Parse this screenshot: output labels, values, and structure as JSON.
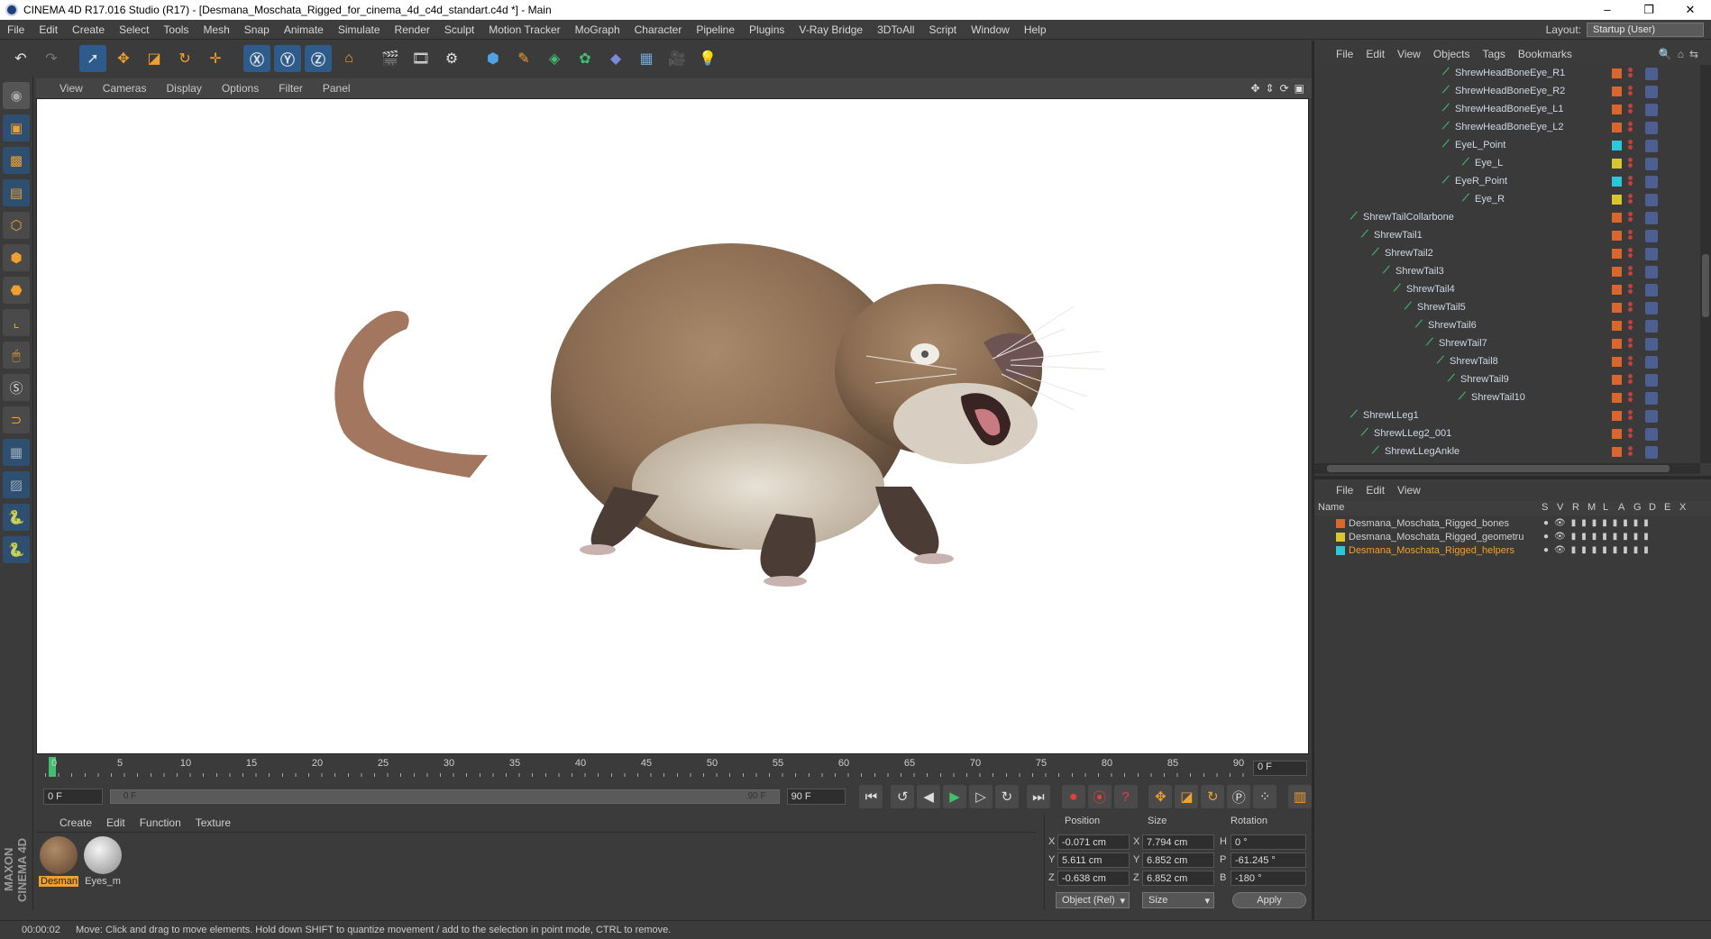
{
  "window": {
    "title": "CINEMA 4D R17.016 Studio (R17) - [Desmana_Moschata_Rigged_for_cinema_4d_c4d_standart.c4d *] - Main",
    "controls": [
      "–",
      "❐",
      "✕"
    ]
  },
  "menubar": {
    "items": [
      "File",
      "Edit",
      "Create",
      "Select",
      "Tools",
      "Mesh",
      "Snap",
      "Animate",
      "Simulate",
      "Render",
      "Sculpt",
      "Motion Tracker",
      "MoGraph",
      "Character",
      "Pipeline",
      "Plugins",
      "V-Ray Bridge",
      "3DToAll",
      "Script",
      "Window",
      "Help"
    ],
    "layout_label": "Layout:",
    "layout_value": "Startup (User)"
  },
  "viewport": {
    "menu": [
      "View",
      "Cameras",
      "Display",
      "Options",
      "Filter",
      "Panel"
    ]
  },
  "timeline": {
    "ticks": [
      "0",
      "5",
      "10",
      "15",
      "20",
      "25",
      "30",
      "35",
      "40",
      "45",
      "50",
      "55",
      "60",
      "65",
      "70",
      "75",
      "80",
      "85",
      "90"
    ],
    "current_frame": "0 F",
    "start_field": "0 F",
    "range_start": "0 F",
    "range_end": "90 F",
    "end_field": "90 F"
  },
  "material_manager": {
    "menu": [
      "Create",
      "Edit",
      "Function",
      "Texture"
    ],
    "materials": [
      {
        "name": "Desman",
        "selected": true
      },
      {
        "name": "Eyes_m",
        "selected": false
      }
    ]
  },
  "coordinates": {
    "headers": [
      "Position",
      "Size",
      "Rotation"
    ],
    "rows": [
      {
        "axis": "X",
        "pos": "-0.071 cm",
        "size_axis": "X",
        "size": "7.794 cm",
        "rot_axis": "H",
        "rot": "0 °"
      },
      {
        "axis": "Y",
        "pos": "5.611 cm",
        "size_axis": "Y",
        "size": "6.852 cm",
        "rot_axis": "P",
        "rot": "-61.245 °"
      },
      {
        "axis": "Z",
        "pos": "-0.638 cm",
        "size_axis": "Z",
        "size": "6.852 cm",
        "rot_axis": "B",
        "rot": "-180 °"
      }
    ],
    "mode": "Object (Rel)",
    "size_mode": "Size",
    "apply": "Apply"
  },
  "object_manager": {
    "menu": [
      "File",
      "Edit",
      "View",
      "Objects",
      "Tags",
      "Bookmarks"
    ],
    "rows": [
      {
        "name": "ShrewHeadBoneEye_R1",
        "indent": 156,
        "color": "#d9662e"
      },
      {
        "name": "ShrewHeadBoneEye_R2",
        "indent": 156,
        "color": "#d9662e"
      },
      {
        "name": "ShrewHeadBoneEye_L1",
        "indent": 156,
        "color": "#d9662e"
      },
      {
        "name": "ShrewHeadBoneEye_L2",
        "indent": 156,
        "color": "#d9662e"
      },
      {
        "name": "EyeL_Point",
        "indent": 156,
        "color": "#2ec7d9"
      },
      {
        "name": "Eye_L",
        "indent": 178,
        "color": "#d9c52e"
      },
      {
        "name": "EyeR_Point",
        "indent": 156,
        "color": "#2ec7d9"
      },
      {
        "name": "Eye_R",
        "indent": 178,
        "color": "#d9c52e"
      },
      {
        "name": "ShrewTailCollarbone",
        "indent": 54,
        "color": "#d9662e"
      },
      {
        "name": "ShrewTail1",
        "indent": 66,
        "color": "#d9662e"
      },
      {
        "name": "ShrewTail2",
        "indent": 78,
        "color": "#d9662e"
      },
      {
        "name": "ShrewTail3",
        "indent": 90,
        "color": "#d9662e"
      },
      {
        "name": "ShrewTail4",
        "indent": 102,
        "color": "#d9662e"
      },
      {
        "name": "ShrewTail5",
        "indent": 114,
        "color": "#d9662e"
      },
      {
        "name": "ShrewTail6",
        "indent": 126,
        "color": "#d9662e"
      },
      {
        "name": "ShrewTail7",
        "indent": 138,
        "color": "#d9662e"
      },
      {
        "name": "ShrewTail8",
        "indent": 150,
        "color": "#d9662e"
      },
      {
        "name": "ShrewTail9",
        "indent": 162,
        "color": "#d9662e"
      },
      {
        "name": "ShrewTail10",
        "indent": 174,
        "color": "#d9662e"
      },
      {
        "name": "ShrewLLeg1",
        "indent": 54,
        "color": "#d9662e"
      },
      {
        "name": "ShrewLLeg2_001",
        "indent": 66,
        "color": "#d9662e"
      },
      {
        "name": "ShrewLLegAnkle",
        "indent": 78,
        "color": "#d9662e"
      }
    ]
  },
  "layer_manager": {
    "menu": [
      "File",
      "Edit",
      "View"
    ],
    "columns": [
      "Name",
      "S",
      "V",
      "R",
      "M",
      "L",
      "A",
      "G",
      "D",
      "E",
      "X"
    ],
    "layers": [
      {
        "name": "Desmana_Moschata_Rigged_bones",
        "color": "#d9662e",
        "highlight": false
      },
      {
        "name": "Desmana_Moschata_Rigged_geometru",
        "color": "#d9c52e",
        "highlight": false
      },
      {
        "name": "Desmana_Moschata_Rigged_helpers",
        "color": "#2ec7d9",
        "highlight": true
      }
    ]
  },
  "status": {
    "time": "00:00:02",
    "message": "Move: Click and drag to move elements. Hold down SHIFT to quantize movement / add to the selection in point mode, CTRL to remove."
  },
  "icons": {
    "toolbar": [
      "undo-icon",
      "redo-icon",
      "live-selection-icon",
      "move-icon",
      "scale-icon",
      "rotate-icon",
      "add-object-icon",
      "x-axis-icon",
      "y-axis-icon",
      "z-axis-icon",
      "world-coordinates-icon",
      "render-view-icon",
      "render-picture-viewer-icon",
      "render-settings-icon",
      "cube-icon",
      "pen-spline-icon",
      "subdivision-icon",
      "cloner-icon",
      "deformer-icon",
      "floor-icon",
      "camera-icon",
      "light-icon"
    ],
    "brand": "MAXON CINEMA 4D"
  },
  "colors": {
    "accent": "#f0a030",
    "selection": "#2d5c8c"
  }
}
